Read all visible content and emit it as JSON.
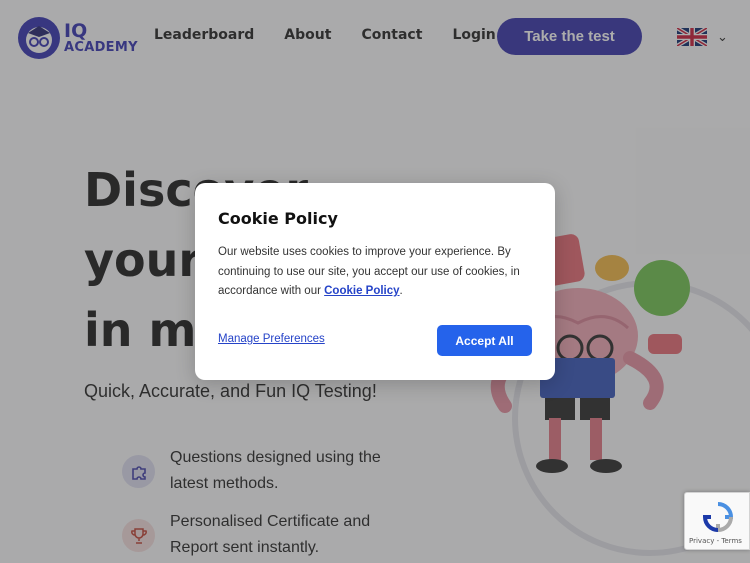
{
  "brand": {
    "line1": "IQ",
    "line2": "ACADEMY"
  },
  "nav": {
    "items": [
      "Leaderboard",
      "About",
      "Contact",
      "Login"
    ]
  },
  "cta": "Take the test",
  "language": {
    "flag": "uk-flag-icon"
  },
  "hero": {
    "title_lines": [
      "Discover",
      "your",
      "in mi"
    ],
    "subtitle": "Quick, Accurate, and Fun IQ Testing!",
    "features": [
      {
        "icon": "puzzle-icon",
        "text": "Questions designed using the latest methods."
      },
      {
        "icon": "trophy-icon",
        "text": "Personalised Certificate and Report sent instantly."
      }
    ]
  },
  "cookie_modal": {
    "title": "Cookie Policy",
    "body_before": "Our website uses cookies to improve your experience. By continuing to use our site, you accept our use of cookies, in accordance with our ",
    "body_link": "Cookie Policy",
    "body_after": ".",
    "manage_label": "Manage Preferences",
    "accept_label": "Accept All"
  },
  "recaptcha": {
    "footer": "Privacy - Terms"
  },
  "colors": {
    "brand": "#2e2aa8",
    "accept": "#2563eb",
    "link": "#2543c8"
  }
}
